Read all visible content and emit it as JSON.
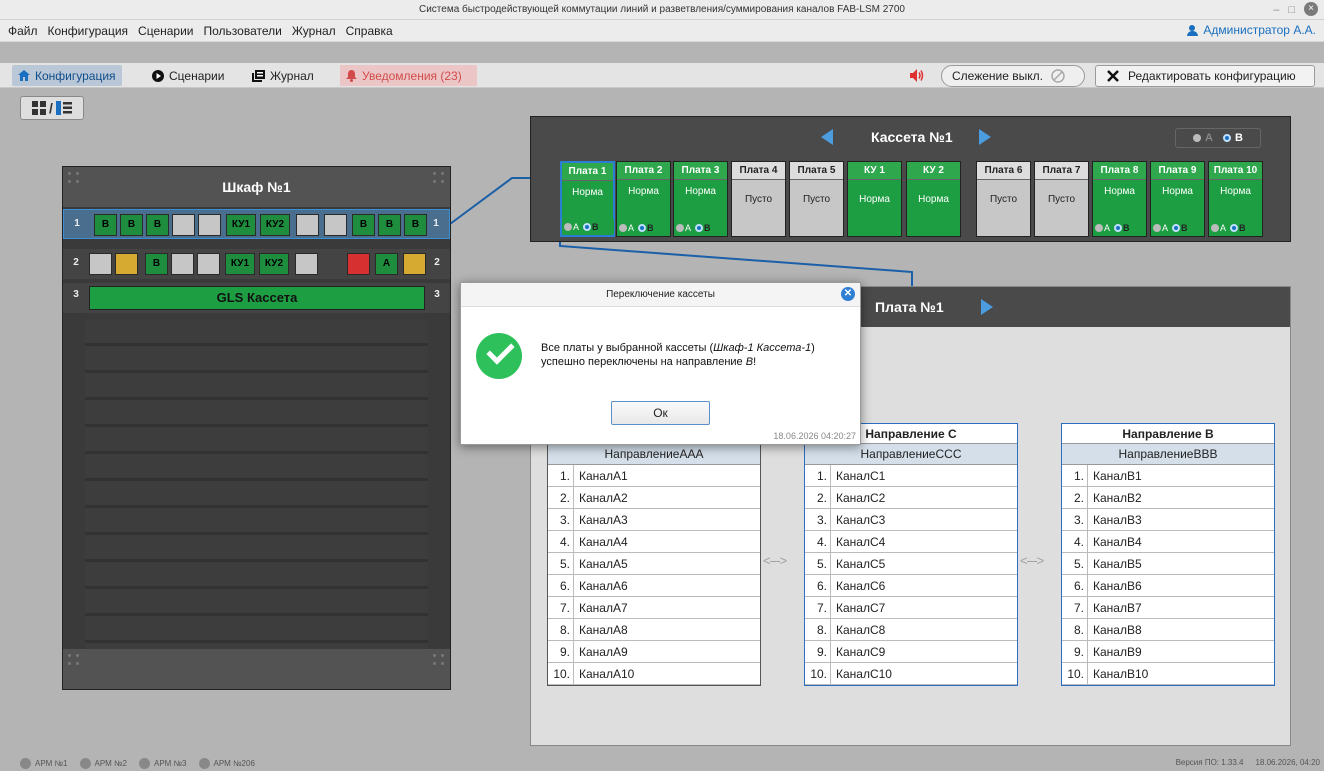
{
  "window": {
    "title": "Система быстродействующей коммутации линий и разветвления/суммирования каналов FAB-LSM 2700",
    "controls": [
      "–",
      "□",
      "×"
    ]
  },
  "menu": {
    "items": [
      "Файл",
      "Конфигурация",
      "Сценарии",
      "Пользователи",
      "Журнал",
      "Справка"
    ],
    "user": "Администратор А.А."
  },
  "tabs": {
    "config": "Конфигурация",
    "scenarios": "Сценарии",
    "journal": "Журнал",
    "notifications": "Уведомления (23)",
    "tracking": "Слежение выкл.",
    "edit": "Редактировать конфигурацию"
  },
  "view_toggle": {
    "separator": "/"
  },
  "cabinet": {
    "title": "Шкаф №1",
    "rows": [
      {
        "num": "1",
        "slots": [
          {
            "label": "B",
            "color": "g"
          },
          {
            "label": "B",
            "color": "g"
          },
          {
            "label": "B",
            "color": "g"
          },
          {
            "label": "",
            "color": "grey"
          },
          {
            "label": "",
            "color": "grey"
          },
          {
            "label": "КУ1",
            "color": "g"
          },
          {
            "label": "КУ2",
            "color": "g"
          },
          {
            "label": "",
            "color": "grey"
          },
          {
            "label": "",
            "color": "grey"
          },
          {
            "label": "B",
            "color": "g"
          },
          {
            "label": "B",
            "color": "g"
          },
          {
            "label": "B",
            "color": "g"
          }
        ]
      },
      {
        "num": "2",
        "slots": [
          {
            "label": "",
            "color": "grey"
          },
          {
            "label": "",
            "color": "y"
          },
          {
            "label": "B",
            "color": "g"
          },
          {
            "label": "",
            "color": "grey"
          },
          {
            "label": "",
            "color": "grey"
          },
          {
            "label": "КУ1",
            "color": "g"
          },
          {
            "label": "КУ2",
            "color": "g"
          },
          {
            "label": "",
            "color": "grey"
          },
          {
            "label": "",
            "color": "r"
          },
          {
            "label": "A",
            "color": "g"
          },
          {
            "label": "",
            "color": "y"
          }
        ]
      },
      {
        "num": "3",
        "label": "GLS Кассета"
      }
    ]
  },
  "cassette": {
    "title": "Кассета №1",
    "ab_a": "A",
    "ab_b": "B",
    "boards": [
      {
        "title": "Плата 1",
        "status": "Норма",
        "color": "g",
        "ab": true
      },
      {
        "title": "Плата 2",
        "status": "Норма",
        "color": "g",
        "ab": true
      },
      {
        "title": "Плата 3",
        "status": "Норма",
        "color": "g",
        "ab": true
      },
      {
        "title": "Плата 4",
        "status": "Пусто",
        "color": "grey",
        "ab": false
      },
      {
        "title": "Плата 5",
        "status": "Пусто",
        "color": "grey",
        "ab": false
      },
      {
        "title": "КУ 1",
        "status": "Норма",
        "color": "g",
        "ab": false
      },
      {
        "title": "КУ 2",
        "status": "Норма",
        "color": "g",
        "ab": false
      },
      {
        "title": "Плата 6",
        "status": "Пусто",
        "color": "grey",
        "ab": false
      },
      {
        "title": "Плата 7",
        "status": "Пусто",
        "color": "grey",
        "ab": false
      },
      {
        "title": "Плата 8",
        "status": "Норма",
        "color": "g",
        "ab": true
      },
      {
        "title": "Плата 9",
        "status": "Норма",
        "color": "g",
        "ab": true
      },
      {
        "title": "Плата 10",
        "status": "Норма",
        "color": "g",
        "ab": true
      }
    ]
  },
  "board_detail": {
    "title": "Плата №1",
    "directions": [
      {
        "title": "",
        "subtitle": "НаправлениеААА",
        "channels": [
          "КаналА1",
          "КаналА2",
          "КаналА3",
          "КаналА4",
          "КаналА5",
          "КаналА6",
          "КаналА7",
          "КаналА8",
          "КаналА9",
          "КаналА10"
        ]
      },
      {
        "title": "Направление С",
        "subtitle": "НаправлениеССС",
        "channels": [
          "КаналС1",
          "КаналС2",
          "КаналС3",
          "КаналС4",
          "КаналС5",
          "КаналС6",
          "КаналС7",
          "КаналС8",
          "КаналС9",
          "КаналС10"
        ]
      },
      {
        "title": "Направление В",
        "subtitle": "НаправлениеВВВ",
        "channels": [
          "КаналВ1",
          "КаналВ2",
          "КаналВ3",
          "КаналВ4",
          "КаналВ5",
          "КаналВ6",
          "КаналВ7",
          "КаналВ8",
          "КаналВ9",
          "КаналВ10"
        ]
      }
    ],
    "connector": "<--->"
  },
  "dialog": {
    "title": "Переключение кассеты",
    "message_part1": "Все платы у выбранной кассеты (",
    "message_italic": "Шкаф-1 Кассета-1",
    "message_part2": ") успешно переключены на направление ",
    "message_dir": "B",
    "message_end": "!",
    "ok": "Ок",
    "timestamp": "18.06.2026 04:20:27"
  },
  "statusbar": {
    "workstations": [
      "АРМ №1",
      "АРМ №2",
      "АРМ №3",
      "АРМ №206"
    ],
    "version": "Версия ПО: 1.33.4",
    "datetime": "18.06.2026, 04:20"
  },
  "colors": {
    "accent": "#1a6fc0",
    "ok_green": "#1e9e43",
    "warn_yellow": "#d6a930",
    "alarm_red": "#d63030"
  }
}
